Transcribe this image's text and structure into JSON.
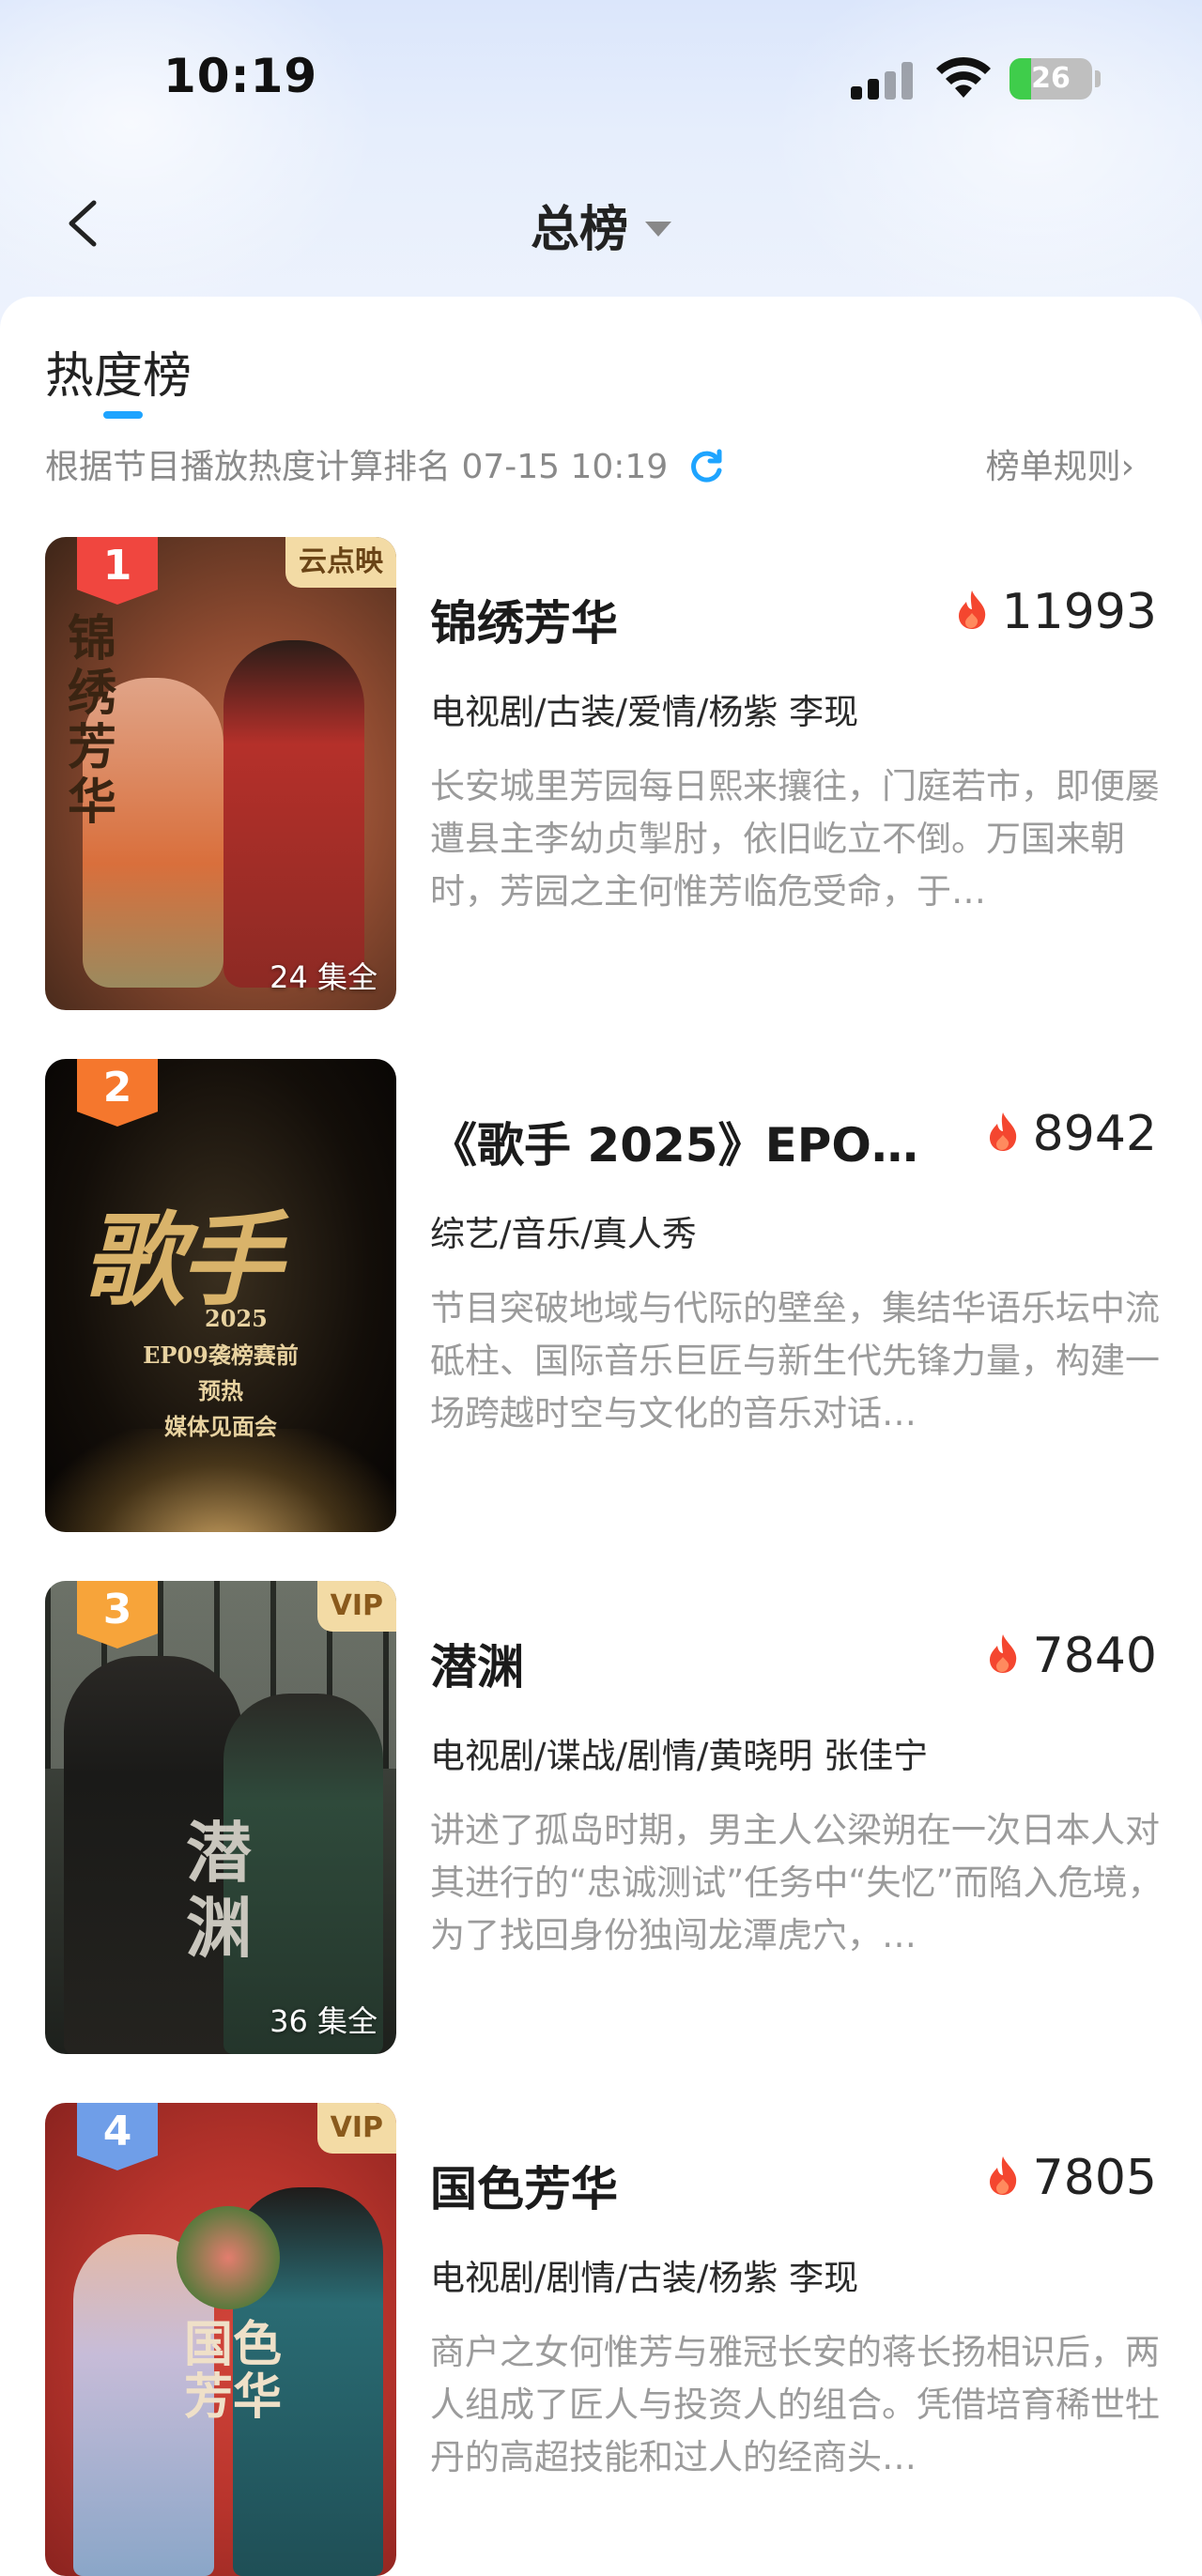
{
  "status_bar": {
    "time": "10:19",
    "battery": "26",
    "icons": [
      "cellular-signal-icon",
      "wifi-icon",
      "battery-charging-icon"
    ]
  },
  "nav": {
    "title": "总榜",
    "back_icon": "chevron-left-icon",
    "dropdown_icon": "caret-down-icon"
  },
  "board": {
    "tab": "热度榜",
    "subtitle": "根据节目播放热度计算排名 07-15 10:19",
    "refresh_icon": "refresh-icon",
    "rules": "榜单规则›"
  },
  "items": [
    {
      "rank": "1",
      "tag": "云点映",
      "episodes": "24 集全",
      "title": "锦绣芳华",
      "heat": "11993",
      "genre": "电视剧/古装/爱情/杨紫 李现",
      "desc": "长安城里芳园每日熙来攘往，门庭若市，即便屡遭县主李幼贞掣肘，依旧屹立不倒。万国来朝时，芳园之主何惟芳临危受命，于…",
      "poster_text": "锦绣芳华"
    },
    {
      "rank": "2",
      "tag": "",
      "episodes": "",
      "title": "《歌手 2025》EPO9 …",
      "heat": "8942",
      "genre": "综艺/音乐/真人秀",
      "desc": "节目突破地域与代际的壁垒，集结华语乐坛中流砥柱、国际音乐巨匠与新生代先锋力量，构建一场跨越时空与文化的音乐对话…",
      "poster_text": "歌手",
      "poster_lines": [
        "2025",
        "EP09袭榜赛前",
        "预热",
        "媒体见面会"
      ]
    },
    {
      "rank": "3",
      "tag": "VIP",
      "episodes": "36 集全",
      "title": "潜渊",
      "heat": "7840",
      "genre": "电视剧/谍战/剧情/黄晓明 张佳宁",
      "desc": "讲述了孤岛时期，男主人公梁朔在一次日本人对其进行的“忠诚测试”任务中“失忆”而陷入危境，为了找回身份独闯龙潭虎穴，…",
      "poster_text": "潜渊"
    },
    {
      "rank": "4",
      "tag": "VIP",
      "episodes": "",
      "title": "国色芳华",
      "heat": "7805",
      "genre": "电视剧/剧情/古装/杨紫 李现",
      "desc": "商户之女何惟芳与雅冠长安的蒋长扬相识后，两人组成了匠人与投资人的组合。凭借培育稀世牡丹的高超技能和过人的经商头…",
      "poster_text": "国色芳华"
    }
  ],
  "colors": {
    "accent": "#1ea4ff",
    "rank1": "#f0463f",
    "rank2": "#f5772d",
    "rank3": "#f7a43a",
    "rank4": "#6f9ee8",
    "flame": "#f4462f",
    "vip": "#8a5a1c"
  }
}
